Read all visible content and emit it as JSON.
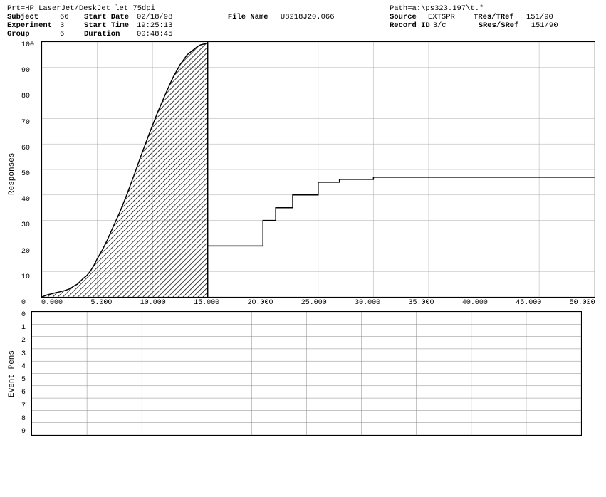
{
  "header": {
    "printer": "Prt=HP LaserJet/DeskJet let 75dpi",
    "path": "Path=a:\\ps323.197\\t.*",
    "subject_label": "Subject",
    "subject_value": "66",
    "start_date_label": "Start Date",
    "start_date_value": "02/18/98",
    "file_name_label": "File Name",
    "file_name_value": "U8218J20.066",
    "experiment_label": "Experiment",
    "experiment_value": "3",
    "start_time_label": "Start Time",
    "start_time_value": "19:25:13",
    "source_label": "Source",
    "source_value": "EXTSPR",
    "tres_tref_label": "TRes/TRef",
    "tres_tref_value": "151/90",
    "group_label": "Group",
    "group_value": "6",
    "duration_label": "Duration",
    "duration_value": "00:48:45",
    "record_id_label": "Record ID",
    "record_id_value": "3/c",
    "sres_sref_label": "SRes/SRef",
    "sres_sref_value": "151/90"
  },
  "main_chart": {
    "y_axis_label": "Responses",
    "y_ticks": [
      "100",
      "90",
      "80",
      "70",
      "60",
      "50",
      "40",
      "30",
      "20",
      "10",
      "0"
    ],
    "x_ticks": [
      "0.000",
      "5.000",
      "10.000",
      "15.000",
      "20.000",
      "25.000",
      "30.000",
      "35.000",
      "40.000",
      "45.000",
      "50.000"
    ]
  },
  "event_pens": {
    "label": "Event Pens",
    "y_ticks": [
      "0",
      "1",
      "2",
      "3",
      "4",
      "5",
      "6",
      "7",
      "8",
      "9"
    ]
  }
}
